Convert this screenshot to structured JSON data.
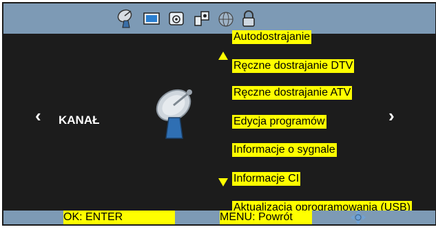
{
  "topbar": {
    "icons": [
      "satellite-dish-icon",
      "picture-icon",
      "sound-icon",
      "settings-icon",
      "globe-icon",
      "lock-icon"
    ]
  },
  "nav": {
    "left_arrow": "‹",
    "right_arrow": "›",
    "section_label": "KANAŁ"
  },
  "menu": {
    "items": [
      "Autodostrajanie",
      "Ręczne dostrajanie DTV",
      "Ręczne dostrajanie ATV",
      "Edycja programów",
      "Informacje o sygnale",
      "Informacje CI",
      "Aktualizacja oprogramowania (USB)"
    ]
  },
  "footer": {
    "ok_label": "OK: ENTER",
    "menu_label": "MENU: Powrót"
  },
  "colors": {
    "highlight": "#ffff00",
    "bar": "#7d9ab5",
    "background": "#1c1c1c"
  }
}
